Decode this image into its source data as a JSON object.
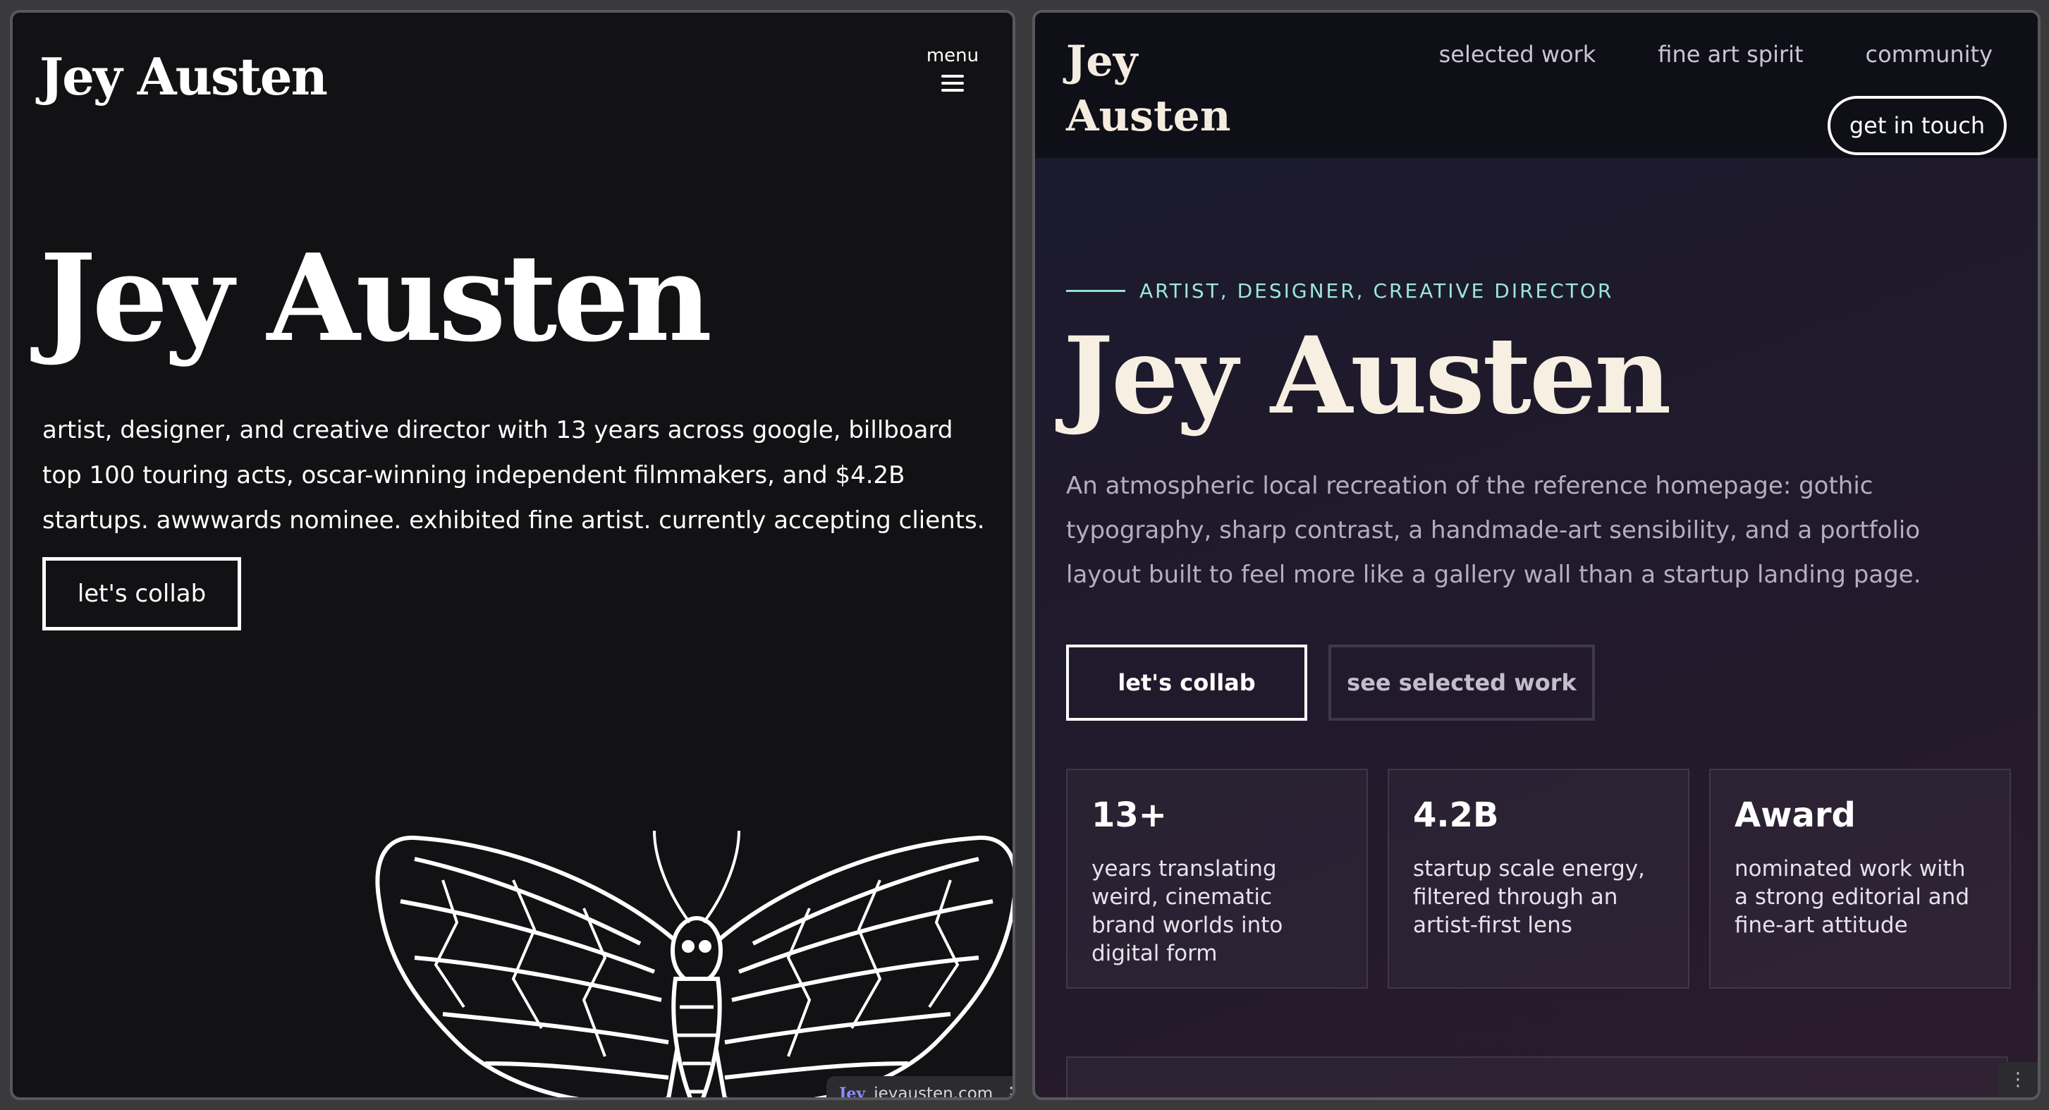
{
  "left": {
    "logo": "Jey Austen",
    "menu_label": "menu",
    "hero_title": "Jey Austen",
    "description": "artist, designer, and creative director with 13 years across google, billboard top 100 touring acts, oscar-winning independent filmmakers, and $4.2B startups. awwwards nominee. exhibited fine artist. currently accepting  clients.",
    "cta": "let's collab",
    "url_logo": "Jey",
    "url": "jeyausten.com",
    "url_menu": "⋮"
  },
  "right": {
    "logo": [
      "Jey",
      "Austen"
    ],
    "nav": [
      "selected work",
      "fine art spirit",
      "community"
    ],
    "get_in_touch": "get in touch",
    "eyebrow": "ARTIST, DESIGNER, CREATIVE DIRECTOR",
    "hero_title": "Jey Austen",
    "description": "An atmospheric local recreation of the reference homepage: gothic typography, sharp contrast, a handmade-art sensibility, and a portfolio layout built to feel more like a gallery wall than a startup landing page.",
    "cta_primary": "let's collab",
    "cta_secondary": "see selected work",
    "stats": [
      {
        "value": "13+",
        "desc": "years translating weird, cinematic brand worlds into digital form"
      },
      {
        "value": "4.2B",
        "desc": "startup scale energy, filtered through an artist-first lens"
      },
      {
        "value": "Award",
        "desc": "nominated work with a strong editorial and fine-art attitude"
      }
    ],
    "corner_menu": "⋮"
  },
  "colors": {
    "left_bg": "#121214",
    "right_accent": "#9ae7db",
    "hero_cream": "#f7efe2"
  },
  "icons": [
    "hamburger-icon",
    "moth-illustration",
    "kebab-menu-icon"
  ]
}
